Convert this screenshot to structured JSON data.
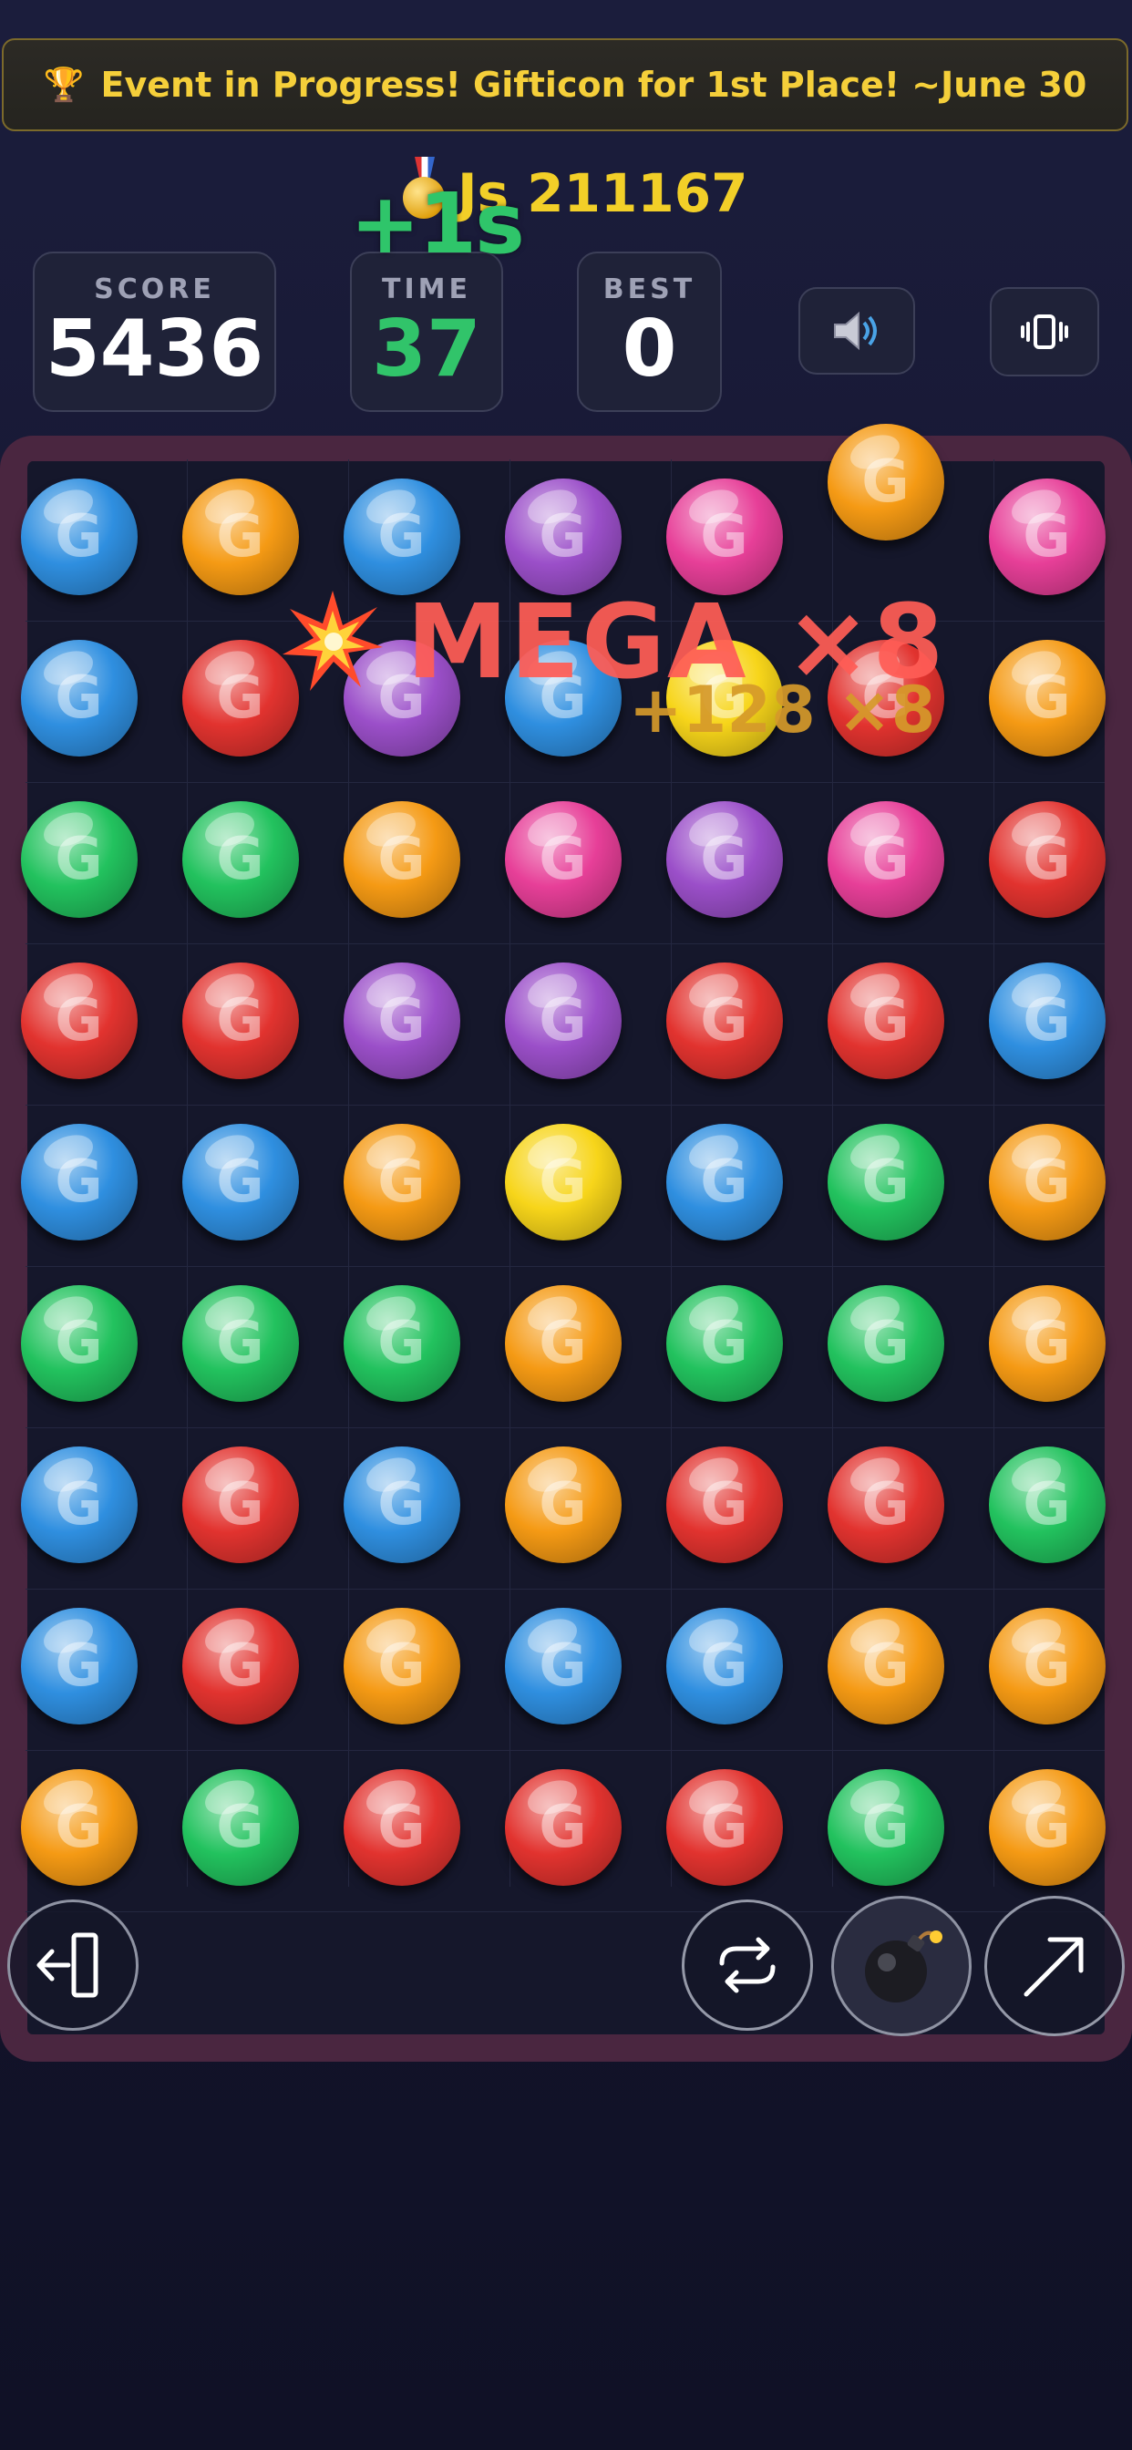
{
  "banner": {
    "icon": "trophy-icon",
    "text": "Event in Progress! Gifticon for 1st Place! ~June 30"
  },
  "rank": {
    "icon": "medal-icon",
    "text": "Js 211167"
  },
  "time_bonus": "+1s",
  "stats": {
    "score": {
      "label": "SCORE",
      "value": "5436"
    },
    "time": {
      "label": "TIME",
      "value": "37"
    },
    "best": {
      "label": "BEST",
      "value": "0"
    }
  },
  "controls": {
    "sound_icon": "speaker-icon",
    "vibrate_icon": "vibrate-icon"
  },
  "combo": {
    "text": "MEGA ×8",
    "points": "+128 ×8",
    "icon": "explosion-icon"
  },
  "gem_symbol": "G",
  "colors": {
    "blue": "#2f8fe0",
    "orange": "#f59a14",
    "purple": "#9b4fc9",
    "pink": "#e73f98",
    "red": "#e2332f",
    "green": "#22c25e",
    "yellow": "#f7d51a",
    "time_green": "#31c46a",
    "banner_gold": "#f5cf3a"
  },
  "board": {
    "columns": 7,
    "rows": [
      [
        "blue",
        "orange",
        "blue",
        "purple",
        "pink",
        "orange",
        "pink"
      ],
      [
        "blue",
        "red",
        "purple",
        "blue",
        "yellow",
        "red",
        "orange"
      ],
      [
        "green",
        "green",
        "orange",
        "pink",
        "purple",
        "pink",
        "red"
      ],
      [
        "red",
        "red",
        "purple",
        "purple",
        "red",
        "red",
        "blue"
      ],
      [
        "blue",
        "blue",
        "orange",
        "yellow",
        "blue",
        "green",
        "orange"
      ],
      [
        "green",
        "green",
        "green",
        "orange",
        "green",
        "green",
        "orange"
      ],
      [
        "blue",
        "red",
        "blue",
        "orange",
        "red",
        "red",
        "green"
      ],
      [
        "blue",
        "red",
        "orange",
        "blue",
        "blue",
        "orange",
        "orange"
      ],
      [
        "orange",
        "green",
        "red",
        "red",
        "red",
        "green",
        "orange"
      ]
    ]
  },
  "bottom_buttons": {
    "exit": "exit-icon",
    "shuffle": "shuffle-icon",
    "bomb": "bomb-icon",
    "hint": "arrow-icon"
  }
}
